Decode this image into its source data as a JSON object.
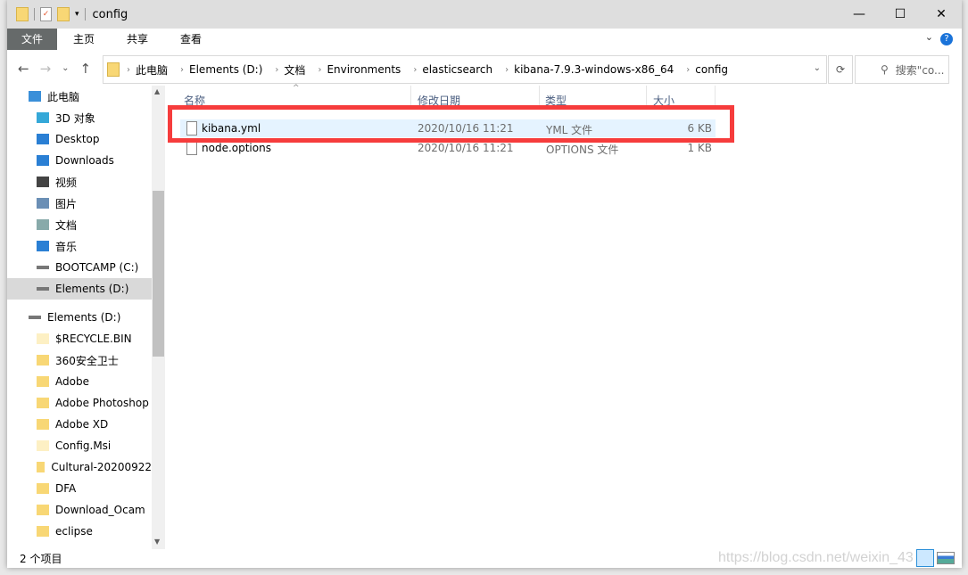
{
  "window": {
    "title": "config"
  },
  "ribbon": {
    "tabs": [
      "文件",
      "主页",
      "共享",
      "查看"
    ],
    "help": "?"
  },
  "address": {
    "crumbs": [
      "此电脑",
      "Elements (D:)",
      "文档",
      "Environments",
      "elasticsearch",
      "kibana-7.9.3-windows-x86_64",
      "config"
    ],
    "search_placeholder": "搜索\"co..."
  },
  "sidebar": {
    "items": [
      {
        "label": "此电脑",
        "icon": "computer-icon",
        "level": 0
      },
      {
        "label": "3D 对象",
        "icon": "3d-objects-icon",
        "level": 1
      },
      {
        "label": "Desktop",
        "icon": "desktop-icon",
        "level": 1
      },
      {
        "label": "Downloads",
        "icon": "downloads-icon",
        "level": 1
      },
      {
        "label": "视频",
        "icon": "videos-icon",
        "level": 1
      },
      {
        "label": "图片",
        "icon": "pictures-icon",
        "level": 1
      },
      {
        "label": "文档",
        "icon": "documents-icon",
        "level": 1
      },
      {
        "label": "音乐",
        "icon": "music-icon",
        "level": 1
      },
      {
        "label": "BOOTCAMP (C:)",
        "icon": "drive-icon",
        "level": 1
      },
      {
        "label": "Elements (D:)",
        "icon": "drive-icon",
        "level": 1,
        "selected": true
      },
      {
        "label": "",
        "icon": "",
        "level": -1
      },
      {
        "label": "Elements (D:)",
        "icon": "drive-icon",
        "level": 0
      },
      {
        "label": "$RECYCLE.BIN",
        "icon": "folder-icon",
        "level": 1
      },
      {
        "label": "360安全卫士",
        "icon": "folder-icon",
        "level": 1
      },
      {
        "label": "Adobe",
        "icon": "folder-icon",
        "level": 1
      },
      {
        "label": "Adobe Photoshop",
        "icon": "folder-icon",
        "level": 1
      },
      {
        "label": "Adobe XD",
        "icon": "folder-icon",
        "level": 1
      },
      {
        "label": "Config.Msi",
        "icon": "folder-icon",
        "level": 1
      },
      {
        "label": "Cultural-20200922",
        "icon": "folder-icon",
        "level": 1
      },
      {
        "label": "DFA",
        "icon": "folder-icon",
        "level": 1
      },
      {
        "label": "Download_Ocam",
        "icon": "folder-icon",
        "level": 1
      },
      {
        "label": "eclipse",
        "icon": "folder-icon",
        "level": 1
      }
    ]
  },
  "columns": [
    "名称",
    "修改日期",
    "类型",
    "大小"
  ],
  "files": [
    {
      "name": "kibana.yml",
      "date": "2020/10/16 11:21",
      "type": "YML 文件",
      "size": "6 KB",
      "highlighted": true
    },
    {
      "name": "node.options",
      "date": "2020/10/16 11:21",
      "type": "OPTIONS 文件",
      "size": "1 KB"
    }
  ],
  "status": {
    "count": "2 个项目"
  },
  "watermark": "https://blog.csdn.net/weixin_43",
  "colors": {
    "annotation": "#f63c3c",
    "selected_row": "#e5f3ff",
    "file_tab": "#666a6a"
  }
}
